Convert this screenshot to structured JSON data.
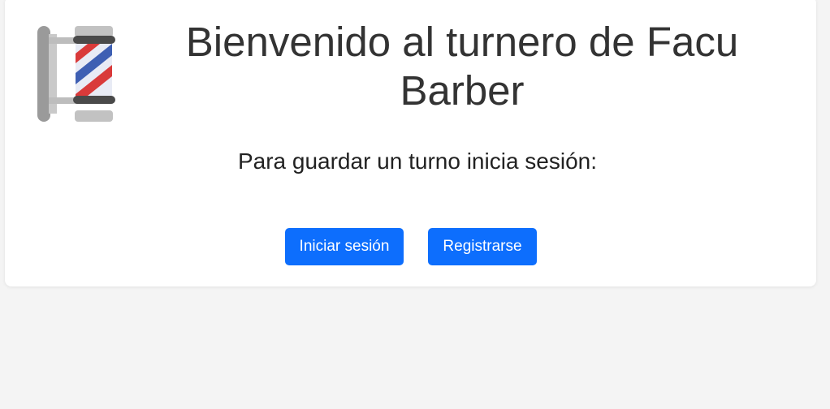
{
  "header": {
    "logo_icon": "barber-pole-icon",
    "title": "Bienvenido al turnero de Facu Barber"
  },
  "main": {
    "subtitle": "Para guardar un turno inicia sesión:",
    "login_button_label": "Iniciar sesión",
    "register_button_label": "Registrarse"
  },
  "colors": {
    "primary_button": "#0d6efd",
    "page_background": "#f4f4f4",
    "card_background": "#ffffff",
    "pole_red": "#d93a3a",
    "pole_blue": "#3e5fb3"
  }
}
